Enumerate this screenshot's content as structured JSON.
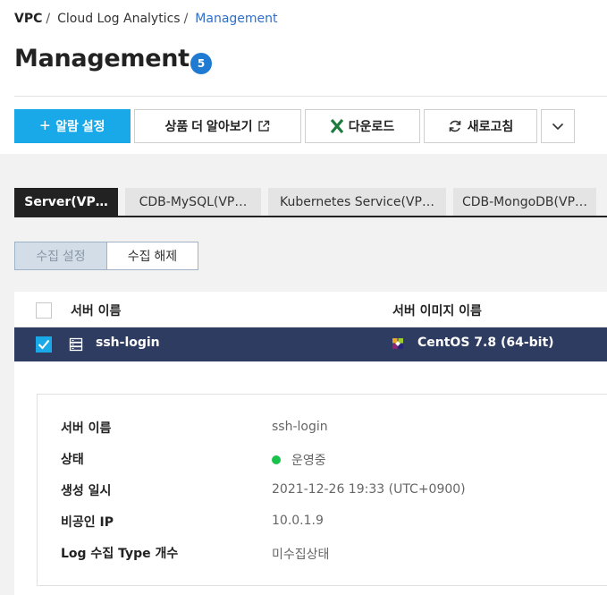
{
  "breadcrumb": {
    "root": "VPC",
    "mid": "Cloud Log Analytics",
    "sep": "/",
    "current": "Management"
  },
  "page": {
    "title": "Management",
    "count": "5"
  },
  "toolbar": {
    "alarm_label": "알람 설정",
    "learn_label": "상품 더 알아보기",
    "download_label": "다운로드",
    "refresh_label": "새로고침"
  },
  "tabs": [
    "Server(VP…",
    "CDB-MySQL(VP…",
    "Kubernetes Service(VP…",
    "CDB-MongoDB(VP…"
  ],
  "collect": {
    "on_label": "수집 설정",
    "off_label": "수집 해제"
  },
  "table": {
    "columns": [
      "서버 이름",
      "서버 이미지 이름"
    ],
    "rows": [
      {
        "name": "ssh-login",
        "image": "CentOS 7.8 (64-bit)",
        "selected": true
      }
    ]
  },
  "detail": {
    "server_name_label": "서버 이름",
    "server_name": "ssh-login",
    "status_label": "상태",
    "status": "운영중",
    "created_label": "생성 일시",
    "created": "2021-12-26 19:33 (UTC+0900)",
    "private_ip_label": "비공인 IP",
    "private_ip": "10.0.1.9",
    "log_type_label": "Log 수집 Type 개수",
    "log_type": "미수집상태"
  },
  "colors": {
    "primary": "#1aa9e8",
    "selected_row": "#2e3c62",
    "badge": "#1f7ad1",
    "status_running": "#19c24a",
    "excel": "#1f7a3e"
  },
  "icons": [
    "plus-icon",
    "external-link-icon",
    "excel-icon",
    "refresh-icon",
    "chevron-down-icon",
    "server-icon",
    "centos-icon",
    "check-icon"
  ]
}
